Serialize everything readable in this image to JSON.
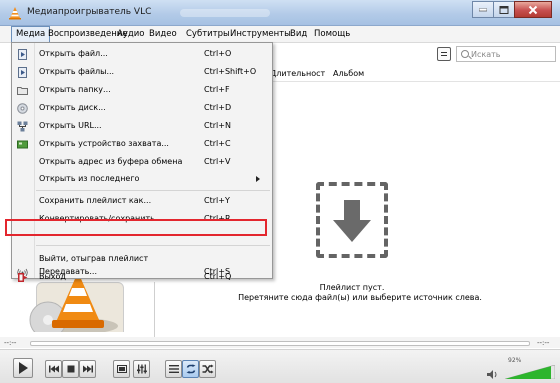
{
  "window": {
    "title": "Медиапроигрыватель VLC",
    "buttons": {
      "minimize": "minimize",
      "maximize": "maximize",
      "close": "close"
    }
  },
  "menubar": {
    "items": [
      {
        "label": "Медиа",
        "active": true
      },
      {
        "label": "Воспроизведение"
      },
      {
        "label": "Аудио"
      },
      {
        "label": "Видео"
      },
      {
        "label": "Субтитры"
      },
      {
        "label": "Инструменты"
      },
      {
        "label": "Вид"
      },
      {
        "label": "Помощь"
      }
    ]
  },
  "media_menu": {
    "items": [
      {
        "label": "Открыть файл...",
        "shortcut": "Ctrl+O",
        "icon": "file-icon"
      },
      {
        "label": "Открыть файлы...",
        "shortcut": "Ctrl+Shift+O",
        "icon": "files-icon"
      },
      {
        "label": "Открыть папку...",
        "shortcut": "Ctrl+F",
        "icon": "folder-icon"
      },
      {
        "label": "Открыть диск...",
        "shortcut": "Ctrl+D",
        "icon": "disc-icon"
      },
      {
        "label": "Открыть URL...",
        "shortcut": "Ctrl+N",
        "icon": "network-icon"
      },
      {
        "label": "Открыть устройство захвата...",
        "shortcut": "Ctrl+C",
        "icon": "capture-card-icon"
      },
      {
        "label": "Открыть адрес из буфера обмена",
        "shortcut": "Ctrl+V",
        "icon": ""
      },
      {
        "label": "Открыть из последнего",
        "shortcut": "",
        "icon": "",
        "submenu": true
      },
      {
        "label": "Сохранить плейлист как...",
        "shortcut": "Ctrl+Y",
        "icon": ""
      },
      {
        "label": "Конвертировать/сохранить...",
        "shortcut": "Ctrl+R",
        "icon": ""
      },
      {
        "label": "Передавать...",
        "shortcut": "Ctrl+S",
        "icon": "stream-icon",
        "highlighted": true
      },
      {
        "label": "Выйти, отыграв плейлист",
        "shortcut": "",
        "icon": ""
      },
      {
        "label": "Выход",
        "shortcut": "Ctrl+Q",
        "icon": "exit-icon"
      }
    ],
    "highlight_color": "#e3262e"
  },
  "playlist": {
    "search_placeholder": "Искать",
    "columns": [
      "Длительност",
      "Альбом"
    ],
    "empty_title": "Плейлист пуст.",
    "empty_hint": "Перетяните сюда файл(ы) или выберите источник слева."
  },
  "player": {
    "elapsed": "--:--",
    "remaining": "--:--",
    "volume_percent": 92,
    "volume_label": "92%",
    "volume_color": "#2db52d"
  },
  "controls": [
    {
      "name": "play-button",
      "icon": "play-icon"
    },
    {
      "name": "previous-button",
      "icon": "previous-icon"
    },
    {
      "name": "stop-button",
      "icon": "stop-icon"
    },
    {
      "name": "next-button",
      "icon": "next-icon"
    },
    {
      "name": "fullscreen-button",
      "icon": "fullscreen-icon"
    },
    {
      "name": "extended-settings-button",
      "icon": "equalizer-icon"
    },
    {
      "name": "playlist-button",
      "icon": "playlist-icon"
    },
    {
      "name": "loop-button",
      "icon": "loop-icon",
      "active": true
    },
    {
      "name": "shuffle-button",
      "icon": "shuffle-icon"
    }
  ]
}
